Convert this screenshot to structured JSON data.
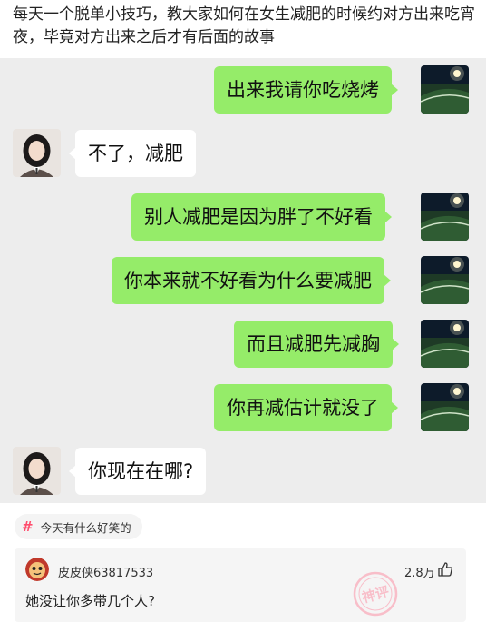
{
  "caption": "每天一个脱单小技巧，教大家如何在女生减肥的时候约对方出来吃宵夜，毕竟对方出来之后才有后面的故事",
  "messages": [
    {
      "side": "right",
      "text": "出来我请你吃烧烤"
    },
    {
      "side": "left",
      "text": "不了，减肥"
    },
    {
      "side": "right",
      "text": "别人减肥是因为胖了不好看"
    },
    {
      "side": "right",
      "text": "你本来就不好看为什么要减肥"
    },
    {
      "side": "right",
      "text": "而且减肥先减胸"
    },
    {
      "side": "right",
      "text": "你再减估计就没了"
    },
    {
      "side": "left",
      "text": "你现在在哪?"
    }
  ],
  "topic": {
    "icon": "hash-icon",
    "label": "今天有什么好笑的"
  },
  "comment": {
    "username": "皮皮侠63817533",
    "likes": "2.8万",
    "text": "她没让你多带几个人?",
    "watermark": "神评"
  },
  "colors": {
    "bubble_green": "#95ec69",
    "chat_bg": "#ededed",
    "accent": "#ff4d6d"
  }
}
